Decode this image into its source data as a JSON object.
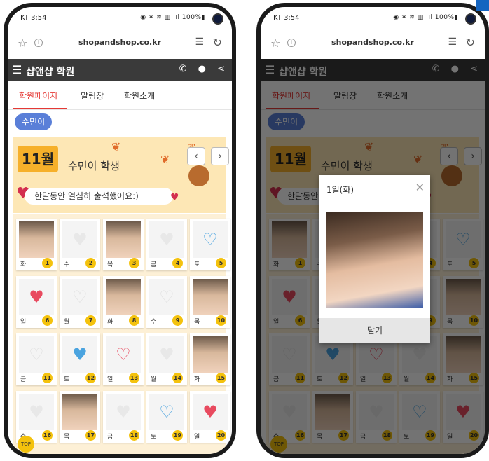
{
  "status": {
    "carrier": "KT 3:54",
    "icons": "◉ ✶ ≋ ▥ .ıl 100%▮"
  },
  "browser": {
    "url": "shopandshop.co.kr"
  },
  "header": {
    "title": "샵앤샵 학원",
    "menu_icon": "hamburger-icon",
    "phone_icon": "phone-icon",
    "location_icon": "location-icon",
    "share_icon": "share-icon"
  },
  "nav": {
    "tabs": [
      "학원페이지",
      "알림장",
      "학원소개"
    ],
    "active": 0
  },
  "student_button": "수민이",
  "banner": {
    "month": "11월",
    "student": "수민이 학생",
    "message": "한달동안 열심히 출석했어요:)"
  },
  "calendar": [
    {
      "day": "1",
      "weekday": "화",
      "photo": true,
      "heart": "",
      "color": ""
    },
    {
      "day": "2",
      "weekday": "수",
      "photo": false,
      "heart": "♥",
      "color": "#e8e8e8"
    },
    {
      "day": "3",
      "weekday": "목",
      "photo": true,
      "heart": "",
      "color": ""
    },
    {
      "day": "4",
      "weekday": "금",
      "photo": false,
      "heart": "♥",
      "color": "#e8e8e8"
    },
    {
      "day": "5",
      "weekday": "토",
      "photo": false,
      "heart": "♡",
      "color": "#4aa3df"
    },
    {
      "day": "6",
      "weekday": "일",
      "photo": false,
      "heart": "♥",
      "color": "#e84a5f"
    },
    {
      "day": "7",
      "weekday": "월",
      "photo": false,
      "heart": "♡",
      "color": "#e0e0e0"
    },
    {
      "day": "8",
      "weekday": "화",
      "photo": true,
      "heart": "",
      "color": ""
    },
    {
      "day": "9",
      "weekday": "수",
      "photo": false,
      "heart": "♡",
      "color": "#e0e0e0"
    },
    {
      "day": "10",
      "weekday": "목",
      "photo": true,
      "heart": "",
      "color": ""
    },
    {
      "day": "11",
      "weekday": "금",
      "photo": false,
      "heart": "♡",
      "color": "#e0e0e0"
    },
    {
      "day": "12",
      "weekday": "토",
      "photo": false,
      "heart": "♥",
      "color": "#4aa3df"
    },
    {
      "day": "13",
      "weekday": "일",
      "photo": false,
      "heart": "♡",
      "color": "#e84a5f"
    },
    {
      "day": "14",
      "weekday": "월",
      "photo": false,
      "heart": "♥",
      "color": "#e8e8e8"
    },
    {
      "day": "15",
      "weekday": "화",
      "photo": true,
      "heart": "",
      "color": ""
    },
    {
      "day": "16",
      "weekday": "수",
      "photo": false,
      "heart": "♥",
      "color": "#e8e8e8"
    },
    {
      "day": "17",
      "weekday": "목",
      "photo": true,
      "heart": "",
      "color": ""
    },
    {
      "day": "18",
      "weekday": "금",
      "photo": false,
      "heart": "♥",
      "color": "#e8e8e8"
    },
    {
      "day": "19",
      "weekday": "토",
      "photo": false,
      "heart": "♡",
      "color": "#4aa3df"
    },
    {
      "day": "20",
      "weekday": "일",
      "photo": false,
      "heart": "♥",
      "color": "#e84a5f"
    }
  ],
  "top_button": "TOP",
  "modal": {
    "title": "1일(화)",
    "close_label": "닫기"
  }
}
